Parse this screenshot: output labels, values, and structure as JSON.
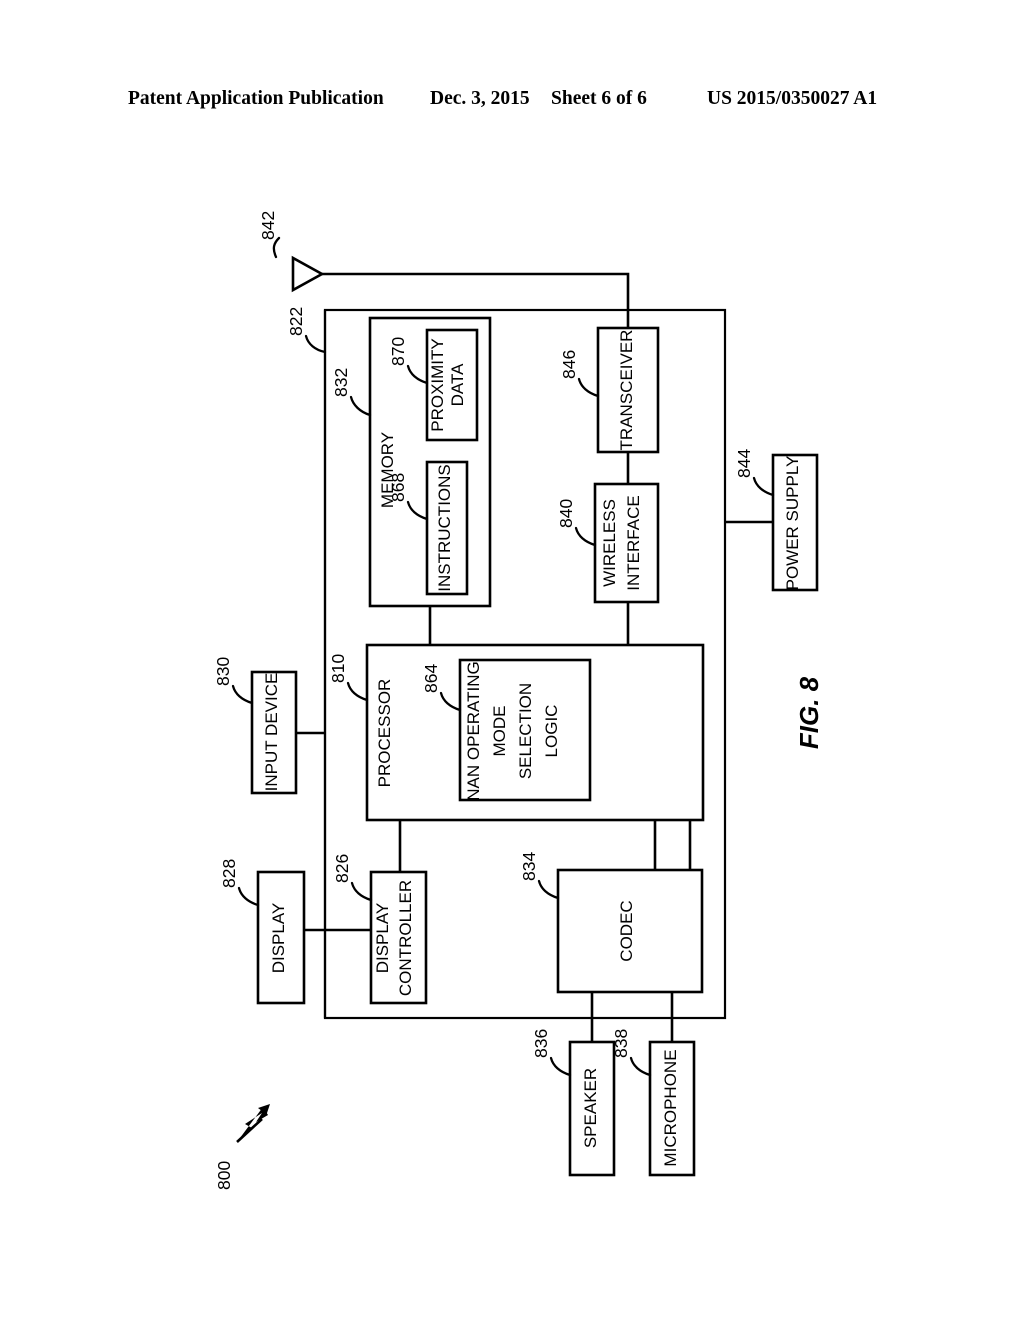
{
  "header": {
    "publication": "Patent Application Publication",
    "date": "Dec. 3, 2015",
    "sheet": "Sheet 6 of 6",
    "number": "US 2015/0350027 A1"
  },
  "figure": {
    "label": "FIG. 8",
    "system_ref": "800"
  },
  "blocks": {
    "antenna": {
      "label": "",
      "ref": "842"
    },
    "device_boundary": {
      "label": "",
      "ref": "822"
    },
    "memory": {
      "label": "MEMORY",
      "ref": "832"
    },
    "proximity_data": {
      "label": "PROXIMITY\nDATA",
      "ref": "870"
    },
    "instructions": {
      "label": "INSTRUCTIONS",
      "ref": "868"
    },
    "transceiver": {
      "label": "TRANSCEIVER",
      "ref": "846"
    },
    "wireless_interface": {
      "label": "WIRELESS\nINTERFACE",
      "ref": "840"
    },
    "power_supply": {
      "label": "POWER SUPPLY",
      "ref": "844"
    },
    "processor": {
      "label": "PROCESSOR",
      "ref": "810"
    },
    "nan_logic": {
      "label": "NAN OPERATING\nMODE\nSELECTION\nLOGIC",
      "ref": "864"
    },
    "input_device": {
      "label": "INPUT DEVICE",
      "ref": "830"
    },
    "display": {
      "label": "DISPLAY",
      "ref": "828"
    },
    "display_controller": {
      "label": "DISPLAY\nCONTROLLER",
      "ref": "826"
    },
    "codec": {
      "label": "CODEC",
      "ref": "834"
    },
    "speaker": {
      "label": "SPEAKER",
      "ref": "836"
    },
    "microphone": {
      "label": "MICROPHONE",
      "ref": "838"
    }
  },
  "block_labels": {
    "memory": "MEMORY",
    "proximity_data_l1": "PROXIMITY",
    "proximity_data_l2": "DATA",
    "instructions": "INSTRUCTIONS",
    "transceiver": "TRANSCEIVER",
    "wireless_interface_l1": "WIRELESS",
    "wireless_interface_l2": "INTERFACE",
    "power_supply": "POWER SUPPLY",
    "processor": "PROCESSOR",
    "nan_l1": "NAN OPERATING",
    "nan_l2": "MODE",
    "nan_l3": "SELECTION",
    "nan_l4": "LOGIC",
    "input_device": "INPUT DEVICE",
    "display": "DISPLAY",
    "display_controller_l1": "DISPLAY",
    "display_controller_l2": "CONTROLLER",
    "codec": "CODEC",
    "speaker": "SPEAKER",
    "microphone": "MICROPHONE"
  },
  "refs": {
    "antenna": "842",
    "device_boundary": "822",
    "memory": "832",
    "proximity_data": "870",
    "instructions": "868",
    "transceiver": "846",
    "wireless_interface": "840",
    "power_supply": "844",
    "processor": "810",
    "nan_logic": "864",
    "input_device": "830",
    "display": "828",
    "display_controller": "826",
    "codec": "834",
    "speaker": "836",
    "microphone": "838",
    "system": "800"
  },
  "colors": {
    "ink": "#000000",
    "paper": "#ffffff"
  }
}
